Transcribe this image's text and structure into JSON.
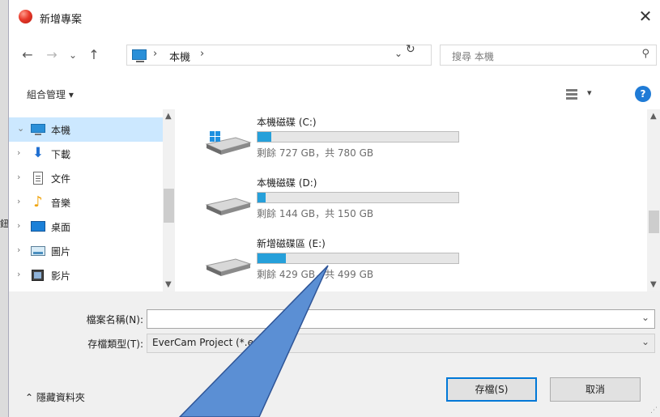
{
  "dialog": {
    "title": "新增專案",
    "close_icon": "close-icon"
  },
  "nav": {
    "back": "←",
    "forward": "→",
    "recent": "⌄",
    "up": "↑",
    "sep": "›",
    "location": "本機",
    "dropdown": "⌄",
    "refresh": "↻"
  },
  "search": {
    "placeholder": "搜尋 本機",
    "icon": "⚲"
  },
  "toolbar": {
    "organize": "組合管理 ▾",
    "view_dropdown": "▾",
    "help": "?"
  },
  "tree": {
    "items": [
      {
        "chevron": "⌄",
        "label": "本機",
        "icon": "computer-icon",
        "selected": true
      },
      {
        "chevron": "›",
        "label": "下載",
        "icon": "download-icon"
      },
      {
        "chevron": "›",
        "label": "文件",
        "icon": "document-icon"
      },
      {
        "chevron": "›",
        "label": "音樂",
        "icon": "music-icon"
      },
      {
        "chevron": "›",
        "label": "桌面",
        "icon": "desktop-icon"
      },
      {
        "chevron": "›",
        "label": "圖片",
        "icon": "pictures-icon"
      },
      {
        "chevron": "›",
        "label": "影片",
        "icon": "video-icon"
      }
    ]
  },
  "drives": [
    {
      "name": "本機磁碟 (C:)",
      "free": "剩餘 727 GB，共 780 GB",
      "used_fraction": 0.07,
      "os_logo": true
    },
    {
      "name": "本機磁碟 (D:)",
      "free": "剩餘 144 GB，共 150 GB",
      "used_fraction": 0.04
    },
    {
      "name": "新增磁碟區 (E:)",
      "free": "剩餘 429 GB，共 499 GB",
      "used_fraction": 0.14
    }
  ],
  "form": {
    "filename_label": "檔案名稱(N):",
    "filename_value": "",
    "type_label": "存檔類型(T):",
    "type_value": "EverCam Project (*.ecp)",
    "dropdown": "⌄"
  },
  "footer": {
    "hide_folders": "⌃  隱藏資料夾",
    "save": "存檔(S)",
    "cancel": "取消"
  },
  "background": {
    "fragment": "鈕"
  },
  "colors": {
    "accent": "#0078d7",
    "drive_bar": "#26a0da",
    "selection": "#cce8ff",
    "callout_fill": "#5b8fd4",
    "callout_stroke": "#2f5597"
  }
}
